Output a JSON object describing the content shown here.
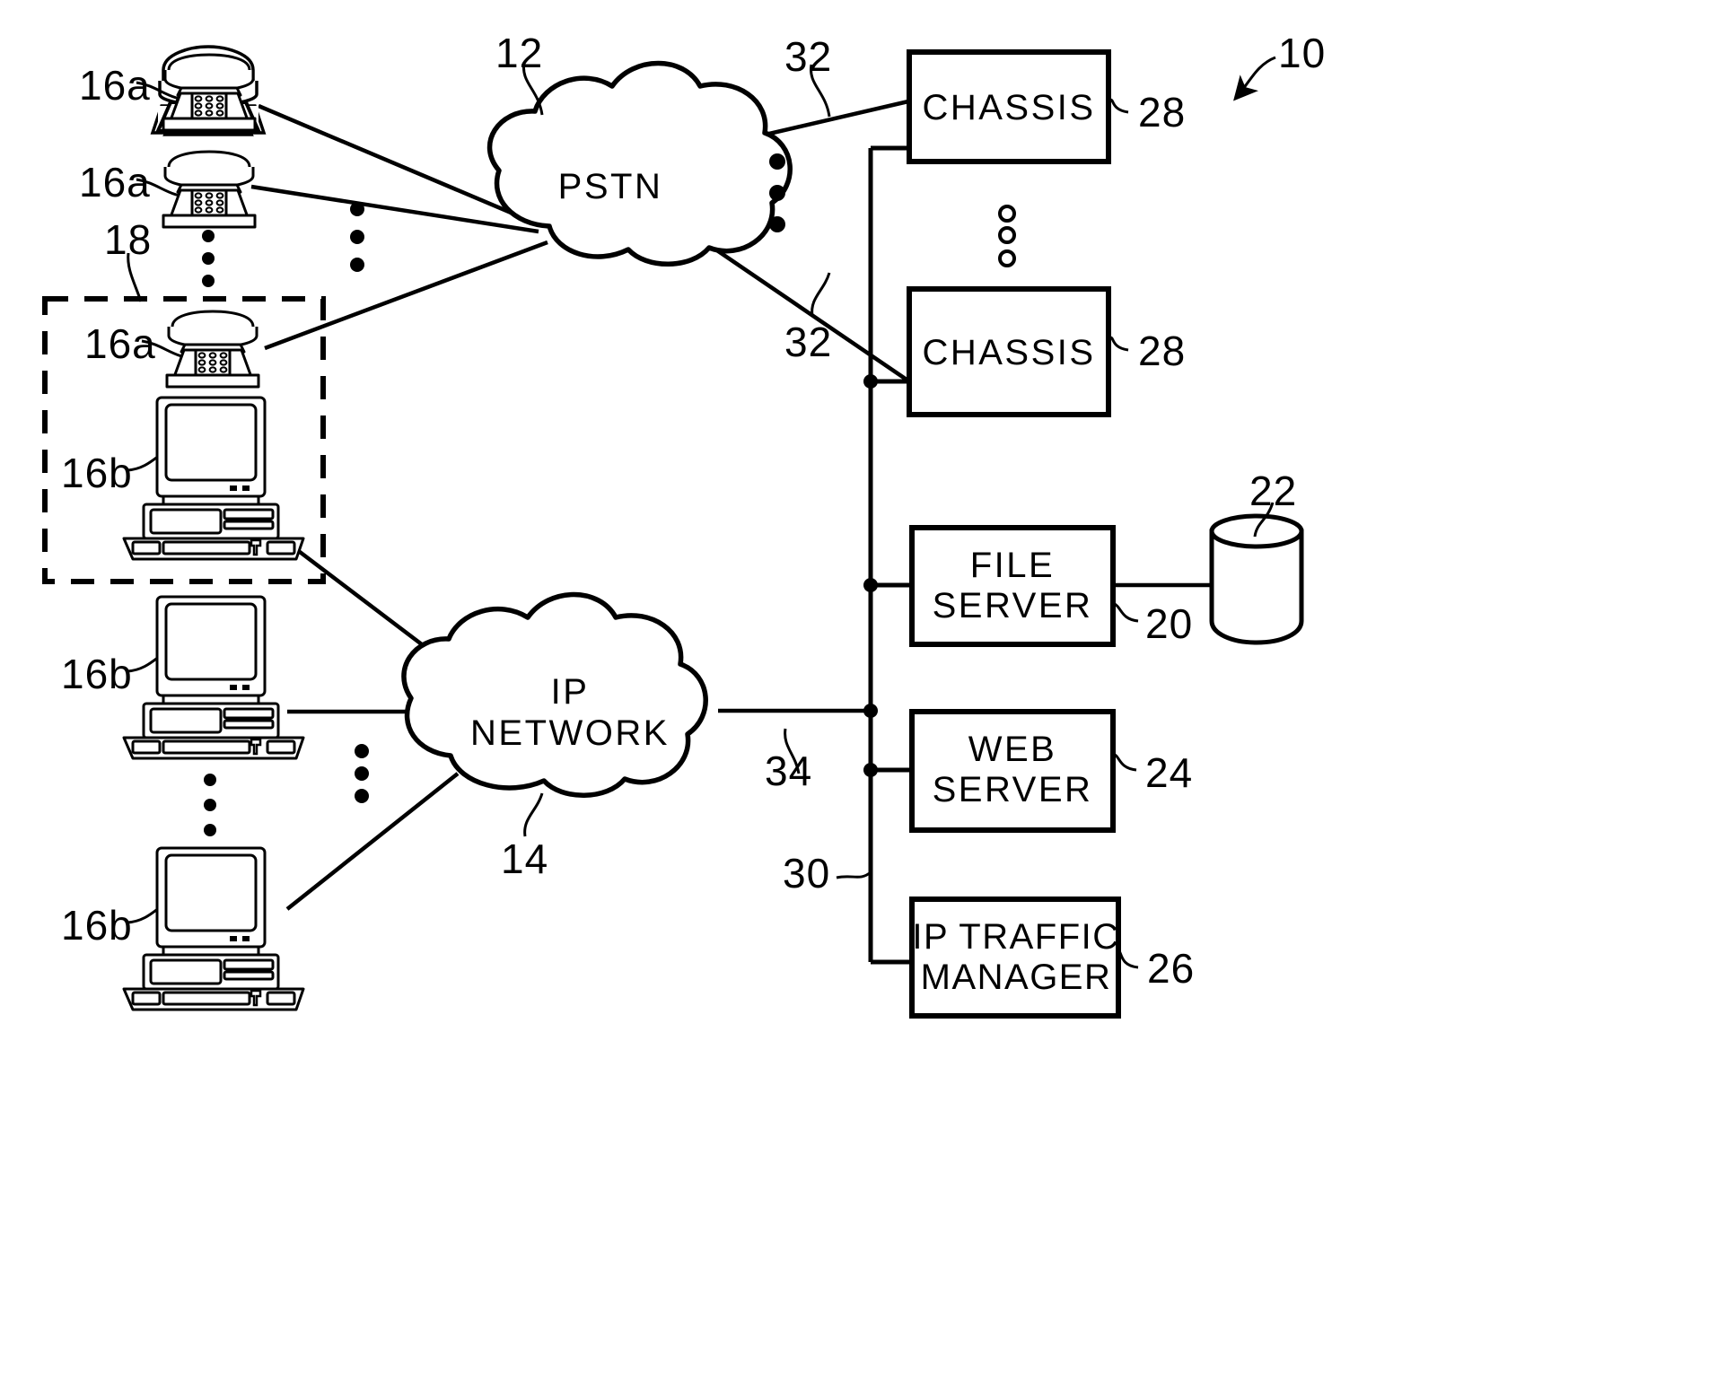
{
  "figure": {
    "figure_ref": "10",
    "background_color": "#ffffff",
    "line_color": "#000000"
  },
  "clouds": [
    {
      "name": "pstn",
      "label": "PSTN",
      "ref": "12"
    },
    {
      "name": "ip-network",
      "label": "IP\nNETWORK",
      "ref": "14"
    }
  ],
  "telephones": [
    {
      "ref": "16a"
    },
    {
      "ref": "16a"
    },
    {
      "ref": "16a"
    }
  ],
  "computers": [
    {
      "ref": "16b"
    },
    {
      "ref": "16b"
    },
    {
      "ref": "16b"
    }
  ],
  "dashed_group": {
    "ref": "18",
    "contains": [
      "16a",
      "16b"
    ]
  },
  "boxes": [
    {
      "name": "chassis-top",
      "label": "CHASSIS",
      "ref": "28"
    },
    {
      "name": "chassis-bottom",
      "label": "CHASSIS",
      "ref": "28"
    },
    {
      "name": "file-server",
      "label": "FILE\nSERVER",
      "ref": "20"
    },
    {
      "name": "web-server",
      "label": "WEB\nSERVER",
      "ref": "24"
    },
    {
      "name": "ip-traffic-manager",
      "label": "IP TRAFFIC\nMANAGER",
      "ref": "26"
    }
  ],
  "database": {
    "name": "storage-database",
    "ref": "22"
  },
  "links": [
    {
      "name": "pstn-to-chassis-top",
      "ref": "32"
    },
    {
      "name": "pstn-to-chassis-bottom",
      "ref": "32"
    },
    {
      "name": "ip-network-to-bus",
      "ref": "34"
    },
    {
      "name": "internal-bus",
      "ref": "30"
    }
  ],
  "ellipses": [
    {
      "name": "telephone-ellipsis",
      "dots": 3
    },
    {
      "name": "pstn-line-ellipsis",
      "dots": 3
    },
    {
      "name": "chassis-line-ellipsis",
      "dots": 3
    },
    {
      "name": "chassis-stack-ellipsis",
      "dots": 3
    },
    {
      "name": "computer-ellipsis",
      "dots": 3
    },
    {
      "name": "ip-line-ellipsis",
      "dots": 3
    }
  ]
}
